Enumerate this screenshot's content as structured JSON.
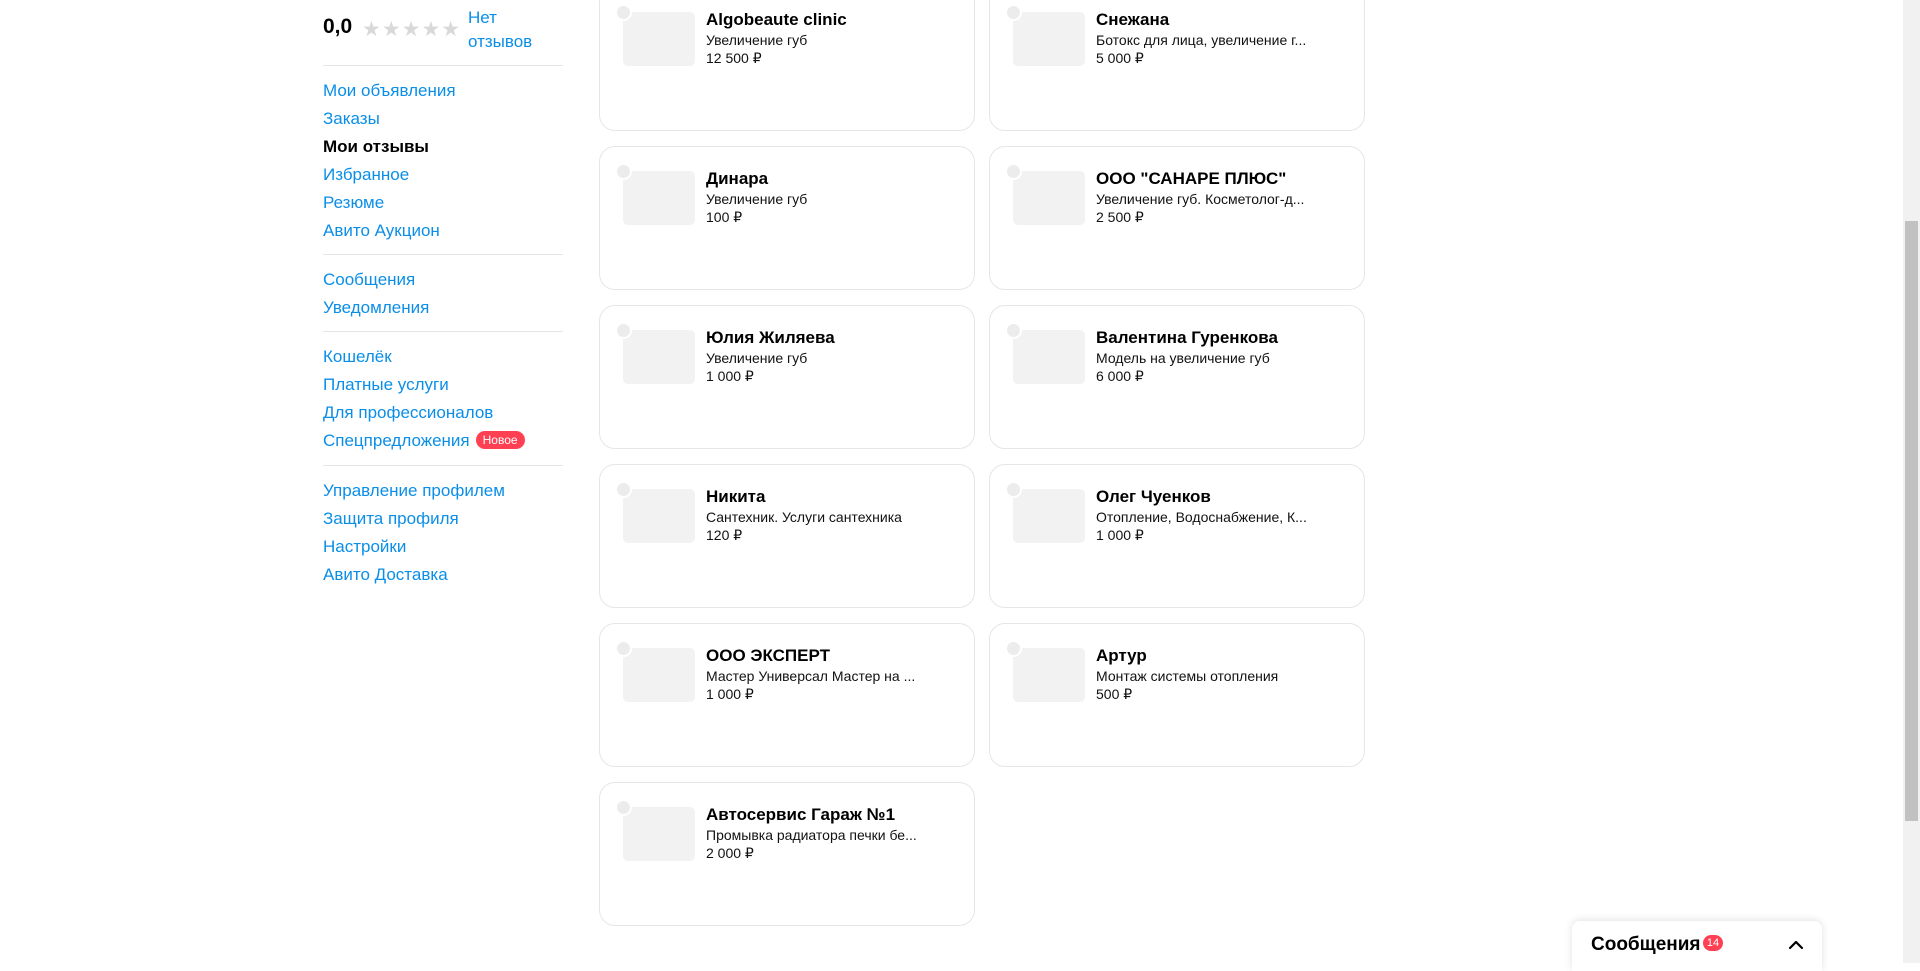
{
  "rating": {
    "value": "0,0",
    "stars": "★★★★★",
    "no_reviews": "Нет отзывов"
  },
  "sidebar": {
    "groups": [
      {
        "items": [
          {
            "label": "Мои объявления",
            "active": false
          },
          {
            "label": "Заказы",
            "active": false
          },
          {
            "label": "Мои отзывы",
            "active": true
          },
          {
            "label": "Избранное",
            "active": false
          },
          {
            "label": "Резюме",
            "active": false
          },
          {
            "label": "Авито Аукцион",
            "active": false
          }
        ]
      },
      {
        "items": [
          {
            "label": "Сообщения",
            "active": false
          },
          {
            "label": "Уведомления",
            "active": false
          }
        ]
      },
      {
        "items": [
          {
            "label": "Кошелёк",
            "active": false
          },
          {
            "label": "Платные услуги",
            "active": false
          },
          {
            "label": "Для профессионалов",
            "active": false
          },
          {
            "label": "Спецпредложения",
            "active": false,
            "badge": "Новое"
          }
        ]
      },
      {
        "items": [
          {
            "label": "Управление профилем",
            "active": false
          },
          {
            "label": "Защита профиля",
            "active": false
          },
          {
            "label": "Настройки",
            "active": false
          },
          {
            "label": "Авито Доставка",
            "active": false
          }
        ]
      }
    ]
  },
  "cards": [
    {
      "name": "Algobeaute clinic",
      "desc": "Увеличение губ",
      "price": "12 500 ₽"
    },
    {
      "name": "Снежана",
      "desc": "Ботокс для лица, увеличение г...",
      "price": "5 000 ₽"
    },
    {
      "name": "Динара",
      "desc": "Увеличение губ",
      "price": "100 ₽"
    },
    {
      "name": "ООО \"САНАРЕ ПЛЮС\"",
      "desc": "Увеличение губ. Косметолог-д...",
      "price": "2 500 ₽"
    },
    {
      "name": "Юлия Жиляева",
      "desc": "Увеличение губ",
      "price": "1 000 ₽"
    },
    {
      "name": "Валентина Гуренкова",
      "desc": "Модель на увеличение губ",
      "price": "6 000 ₽"
    },
    {
      "name": "Никита",
      "desc": "Сантехник. Услуги сантехника",
      "price": "120 ₽"
    },
    {
      "name": "Олег Чуенков",
      "desc": "Отопление, Водоснабжение, К...",
      "price": "1 000 ₽"
    },
    {
      "name": "ООО ЭКСПЕРТ",
      "desc": "Мастер Универсал Мастер на ...",
      "price": "1 000 ₽"
    },
    {
      "name": "Артур",
      "desc": "Монтаж системы отопления",
      "price": "500 ₽"
    },
    {
      "name": "Автосервис Гараж №1",
      "desc": "Промывка радиатора печки бе...",
      "price": "2 000 ₽"
    }
  ],
  "messages_widget": {
    "title": "Сообщения",
    "count": "14",
    "icon": "chevron-up-icon"
  },
  "colors": {
    "link": "#0a8ee8",
    "badge": "#ff4053",
    "border": "#e6e6e6",
    "thumb": "#f2f2f2"
  }
}
